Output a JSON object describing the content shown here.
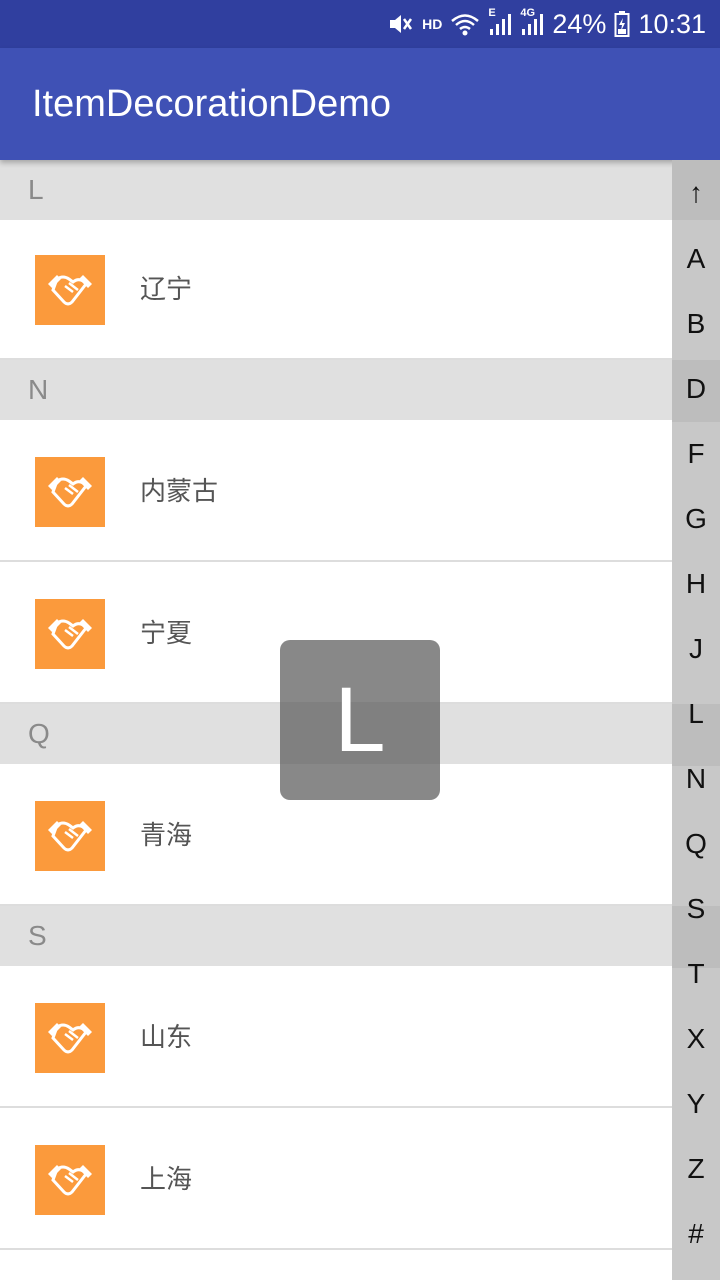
{
  "status_bar": {
    "hd_label": "HD",
    "battery_percent": "24%",
    "time": "10:31",
    "network_label_1": "E",
    "network_label_2": "4G"
  },
  "app_bar": {
    "title": "ItemDecorationDemo"
  },
  "list": {
    "sections": [
      {
        "letter": "L",
        "items": [
          "辽宁"
        ]
      },
      {
        "letter": "N",
        "items": [
          "内蒙古",
          "宁夏"
        ]
      },
      {
        "letter": "Q",
        "items": [
          "青海"
        ]
      },
      {
        "letter": "S",
        "items": [
          "山东",
          "上海"
        ]
      }
    ]
  },
  "index_bar": {
    "letters": [
      "↑",
      "A",
      "B",
      "D",
      "F",
      "G",
      "H",
      "J",
      "L",
      "N",
      "Q",
      "S",
      "T",
      "X",
      "Y",
      "Z",
      "#"
    ]
  },
  "toast": {
    "letter": "L"
  },
  "colors": {
    "status_bar": "#303F9F",
    "app_bar": "#3F51B5",
    "section_header": "#E0E0E0",
    "item_icon_bg": "#FB9A3C",
    "index_bar": "#C8C8C8"
  },
  "icons": {
    "item_icon": "handshake-icon"
  }
}
